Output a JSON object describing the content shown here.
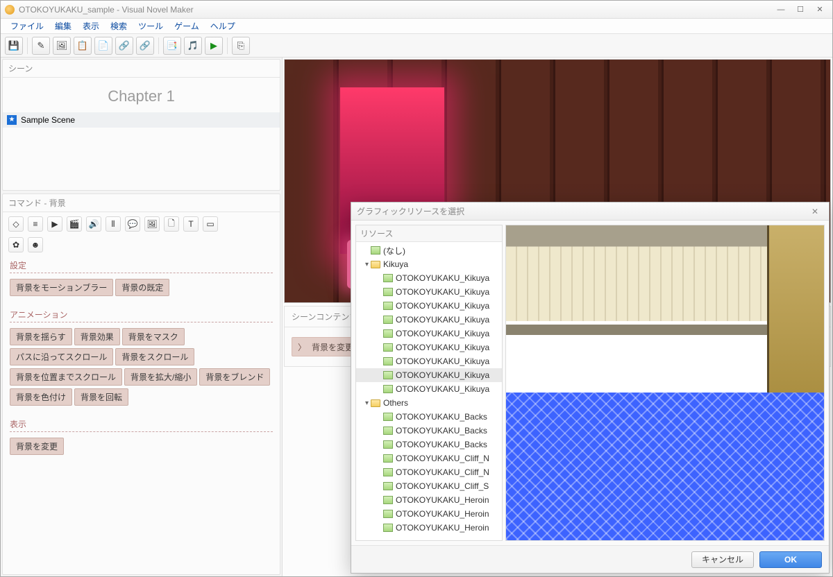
{
  "window": {
    "title": "OTOKOYUKAKU_sample - Visual Novel Maker",
    "min": "—",
    "max": "☐",
    "close": "✕"
  },
  "menus": [
    "ファイル",
    "編集",
    "表示",
    "検索",
    "ツール",
    "ゲーム",
    "ヘルプ"
  ],
  "toolbar_icons": [
    "💾",
    "│",
    "✎",
    "🖼",
    "📋",
    "📄",
    "🔗",
    "🔗",
    "│",
    "📑",
    "🎵",
    "▶",
    "│",
    "⎘"
  ],
  "scene_panel": {
    "title": "シーン",
    "chapter": "Chapter 1",
    "scene": "Sample Scene"
  },
  "command_panel": {
    "title": "コマンド - 背景",
    "row1": [
      "◇",
      "≡",
      "▶",
      "🎬",
      "🔊",
      "⦀",
      "💬",
      "🖼",
      "🗋",
      "T",
      "▭"
    ],
    "row2": [
      "✿",
      "☻"
    ],
    "sections": [
      {
        "title": "設定",
        "buttons": [
          "背景をモーションブラー",
          "背景の既定"
        ]
      },
      {
        "title": "アニメーション",
        "buttons": [
          "背景を揺らす",
          "背景効果",
          "背景をマスク",
          "パスに沿ってスクロール",
          "背景をスクロール",
          "背景を位置までスクロール",
          "背景を拡大/縮小",
          "背景をブレンド",
          "背景を色付け",
          "背景を回転"
        ]
      },
      {
        "title": "表示",
        "buttons": [
          "背景を変更"
        ]
      }
    ]
  },
  "scene_contents": {
    "title": "シーンコンテンツ",
    "row": "背景を変更"
  },
  "dialog": {
    "title": "グラフィックリソースを選択",
    "resource_header": "リソース",
    "tree": [
      {
        "d": 0,
        "tw": "",
        "kind": "img",
        "label": "(なし)"
      },
      {
        "d": 0,
        "tw": "▾",
        "kind": "dir",
        "label": "Kikuya"
      },
      {
        "d": 1,
        "tw": "",
        "kind": "img",
        "label": "OTOKOYUKAKU_Kikuya"
      },
      {
        "d": 1,
        "tw": "",
        "kind": "img",
        "label": "OTOKOYUKAKU_Kikuya"
      },
      {
        "d": 1,
        "tw": "",
        "kind": "img",
        "label": "OTOKOYUKAKU_Kikuya"
      },
      {
        "d": 1,
        "tw": "",
        "kind": "img",
        "label": "OTOKOYUKAKU_Kikuya"
      },
      {
        "d": 1,
        "tw": "",
        "kind": "img",
        "label": "OTOKOYUKAKU_Kikuya"
      },
      {
        "d": 1,
        "tw": "",
        "kind": "img",
        "label": "OTOKOYUKAKU_Kikuya"
      },
      {
        "d": 1,
        "tw": "",
        "kind": "img",
        "label": "OTOKOYUKAKU_Kikuya"
      },
      {
        "d": 1,
        "tw": "",
        "kind": "img",
        "label": "OTOKOYUKAKU_Kikuya",
        "sel": true
      },
      {
        "d": 1,
        "tw": "",
        "kind": "img",
        "label": "OTOKOYUKAKU_Kikuya"
      },
      {
        "d": 0,
        "tw": "▾",
        "kind": "dir",
        "label": "Others"
      },
      {
        "d": 1,
        "tw": "",
        "kind": "img",
        "label": "OTOKOYUKAKU_Backs"
      },
      {
        "d": 1,
        "tw": "",
        "kind": "img",
        "label": "OTOKOYUKAKU_Backs"
      },
      {
        "d": 1,
        "tw": "",
        "kind": "img",
        "label": "OTOKOYUKAKU_Backs"
      },
      {
        "d": 1,
        "tw": "",
        "kind": "img",
        "label": "OTOKOYUKAKU_Cliff_N"
      },
      {
        "d": 1,
        "tw": "",
        "kind": "img",
        "label": "OTOKOYUKAKU_Cliff_N"
      },
      {
        "d": 1,
        "tw": "",
        "kind": "img",
        "label": "OTOKOYUKAKU_Cliff_S"
      },
      {
        "d": 1,
        "tw": "",
        "kind": "img",
        "label": "OTOKOYUKAKU_Heroin"
      },
      {
        "d": 1,
        "tw": "",
        "kind": "img",
        "label": "OTOKOYUKAKU_Heroin"
      },
      {
        "d": 1,
        "tw": "",
        "kind": "img",
        "label": "OTOKOYUKAKU_Heroin"
      }
    ],
    "cancel": "キャンセル",
    "ok": "OK"
  }
}
